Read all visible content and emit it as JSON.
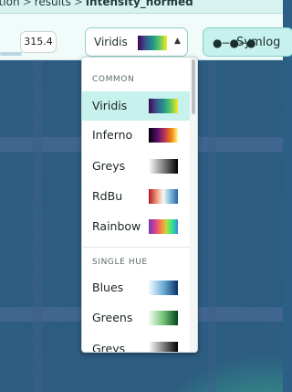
{
  "breadcrumb": {
    "items": [
      "ction",
      "results",
      "intensity_normed"
    ],
    "separator": ">"
  },
  "toolbar": {
    "domain_max": "315.4",
    "colormap_selected": "Viridis",
    "symlog_label": "Symlog"
  },
  "menu": {
    "group_common": "COMMON",
    "group_single_hue": "SINGLE HUE",
    "common_options": [
      {
        "label": "Viridis",
        "icon": "viridis",
        "selected": true
      },
      {
        "label": "Inferno",
        "icon": "inferno",
        "selected": false
      },
      {
        "label": "Greys",
        "icon": "greys",
        "selected": false
      },
      {
        "label": "RdBu",
        "icon": "rdbu",
        "selected": false
      },
      {
        "label": "Rainbow",
        "icon": "rainbow",
        "selected": false
      }
    ],
    "single_hue_options": [
      {
        "label": "Blues",
        "icon": "blues"
      },
      {
        "label": "Greens",
        "icon": "greens"
      },
      {
        "label": "Greys",
        "icon": "greys"
      }
    ]
  },
  "colors": {
    "accent": "#c6f1ec",
    "heatmap_base": "#2c5d84"
  }
}
